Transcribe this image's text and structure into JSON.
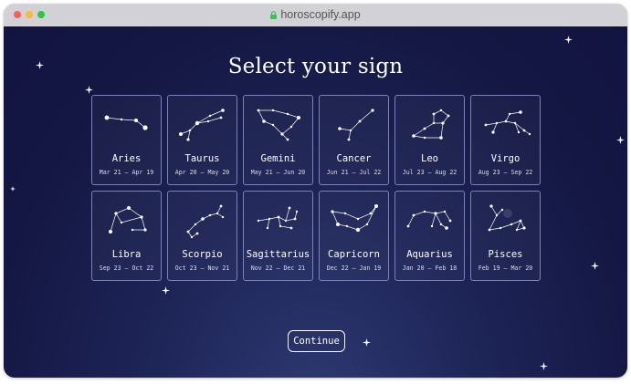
{
  "browser": {
    "url": "horoscopify.app"
  },
  "page": {
    "title": "Select your sign",
    "continue_label": "Continue"
  },
  "signs": [
    {
      "name": "Aries",
      "dates": "Mar 21 – Apr 19"
    },
    {
      "name": "Taurus",
      "dates": "Apr 20 – May 20"
    },
    {
      "name": "Gemini",
      "dates": "May 21 – Jun 20"
    },
    {
      "name": "Cancer",
      "dates": "Jun 21 – Jul 22"
    },
    {
      "name": "Leo",
      "dates": "Jul 23 – Aug 22"
    },
    {
      "name": "Virgo",
      "dates": "Aug 23 – Sep 22"
    },
    {
      "name": "Libra",
      "dates": "Sep 23 – Oct 22"
    },
    {
      "name": "Scorpio",
      "dates": "Oct 23 – Nov 21"
    },
    {
      "name": "Sagittarius",
      "dates": "Nov 22 – Dec 21"
    },
    {
      "name": "Capricorn",
      "dates": "Dec 22 – Jan 19"
    },
    {
      "name": "Aquarius",
      "dates": "Jan 20 – Feb 18"
    },
    {
      "name": "Pisces",
      "dates": "Feb 19 – Mar 20"
    }
  ]
}
